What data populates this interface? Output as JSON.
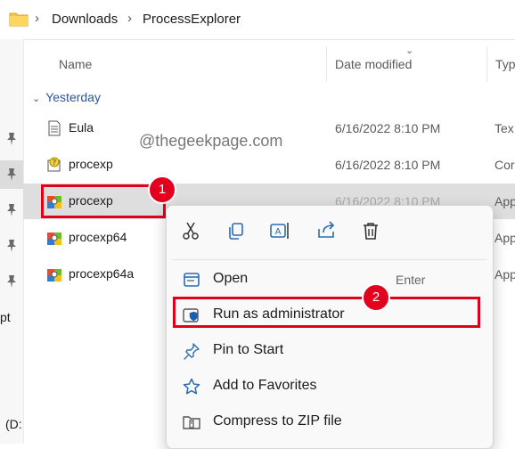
{
  "breadcrumb": {
    "items": [
      "Downloads",
      "ProcessExplorer"
    ]
  },
  "columns": {
    "name": "Name",
    "date": "Date modified",
    "type": "Typ"
  },
  "group": {
    "label": "Yesterday"
  },
  "files": [
    {
      "name": "Eula",
      "date": "6/16/2022 8:10 PM",
      "type": "Tex",
      "icon": "text-file-icon"
    },
    {
      "name": "procexp",
      "date": "6/16/2022 8:10 PM",
      "type": "Cor",
      "icon": "help-file-icon"
    },
    {
      "name": "procexp",
      "date": "6/16/2022 8:10 PM",
      "type": "App",
      "icon": "app-icon"
    },
    {
      "name": "procexp64",
      "date": "",
      "type": "App",
      "icon": "app-icon"
    },
    {
      "name": "procexp64a",
      "date": "",
      "type": "App",
      "icon": "app-icon"
    }
  ],
  "nav": {
    "partial_text_1": "pt",
    "partial_text_2": "(D:"
  },
  "watermark": "@thegeekpage.com",
  "annotations": {
    "badge1": "1",
    "badge2": "2",
    "color": "#e0001b"
  },
  "context_menu": {
    "quick_actions": [
      "cut-icon",
      "copy-icon",
      "rename-icon",
      "share-icon",
      "delete-icon"
    ],
    "items": [
      {
        "label": "Open",
        "shortcut": "Enter",
        "icon": "open-icon"
      },
      {
        "label": "Run as administrator",
        "shortcut": "",
        "icon": "shield-icon"
      },
      {
        "label": "Pin to Start",
        "shortcut": "",
        "icon": "pin-icon"
      },
      {
        "label": "Add to Favorites",
        "shortcut": "",
        "icon": "star-icon"
      },
      {
        "label": "Compress to ZIP file",
        "shortcut": "",
        "icon": "zip-icon"
      }
    ]
  },
  "colors": {
    "accent": "#0067c0",
    "selection": "#dedede",
    "group_text": "#2b5797"
  }
}
